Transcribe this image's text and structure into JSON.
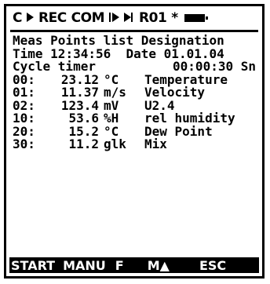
{
  "status": {
    "c": "C",
    "rec": "REC",
    "com": "COM",
    "r01": "R01",
    "star": "*"
  },
  "header": {
    "title": "Meas Points list",
    "designation": "Designation",
    "time_label": "Time",
    "time": "12:34:56",
    "date_label": "Date",
    "date": "01.01.04",
    "cycle_label": "Cycle timer",
    "cycle": "00:00:30 Sn"
  },
  "points": [
    {
      "chan": "00:",
      "val": "23.12",
      "unit": "°C",
      "name": "Temperature"
    },
    {
      "chan": "01:",
      "val": "11.37",
      "unit": "m/s",
      "name": "Velocity"
    },
    {
      "chan": "02:",
      "val": "123.4",
      "unit": "mV",
      "name": "U2.4"
    },
    {
      "chan": "10:",
      "val": "53.6",
      "unit": "%H",
      "name": "rel humidity"
    },
    {
      "chan": "20:",
      "val": "15.2",
      "unit": "°C",
      "name": "Dew Point"
    },
    {
      "chan": "30:",
      "val": "11.2",
      "unit": "glk",
      "name": "Mix"
    }
  ],
  "softkeys": {
    "start": "START",
    "manu": "MANU",
    "f": "F",
    "m": "M▲",
    "esc": "ESC"
  }
}
